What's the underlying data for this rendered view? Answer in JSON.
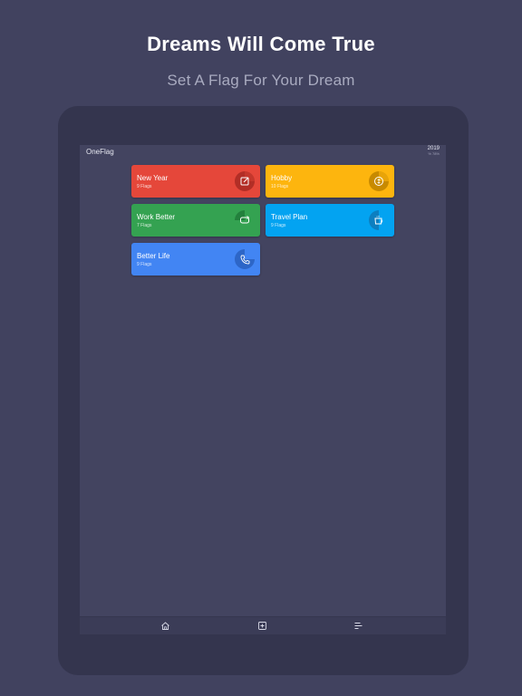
{
  "headline": "Dreams Will Come True",
  "subheadline": "Set A Flag For Your Dream",
  "app": {
    "title": "OneFlag",
    "year": "2019",
    "year_progress": "% 78%"
  },
  "cards": [
    {
      "title": "New Year",
      "count": "9 Flags",
      "color": "#e5473a",
      "icon": "edit-icon"
    },
    {
      "title": "Hobby",
      "count": "10 Flags",
      "color": "#fdb50e",
      "icon": "money-icon"
    },
    {
      "title": "Work Better",
      "count": "7 Flags",
      "color": "#34a251",
      "icon": "repeat-icon"
    },
    {
      "title": "Travel Plan",
      "count": "9 Flags",
      "color": "#03a3f1",
      "icon": "coffee-icon"
    },
    {
      "title": "Better Life",
      "count": "9 Flags",
      "color": "#4285f3",
      "icon": "phone-icon"
    }
  ],
  "tabs": [
    {
      "name": "home",
      "icon": "home-icon",
      "active": true
    },
    {
      "name": "add",
      "icon": "add-icon",
      "active": false
    },
    {
      "name": "list",
      "icon": "list-icon",
      "active": false
    }
  ]
}
